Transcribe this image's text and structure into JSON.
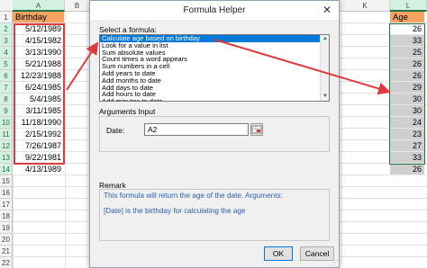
{
  "sheet": {
    "left_columns": [
      "A",
      "B"
    ],
    "right_columns": [
      "K",
      "L"
    ],
    "row_numbers": [
      "1",
      "2",
      "3",
      "4",
      "5",
      "6",
      "7",
      "8",
      "9",
      "10",
      "11",
      "12",
      "13",
      "14",
      "15",
      "16",
      "17",
      "18",
      "19",
      "20",
      "21",
      "22"
    ],
    "birthday_header": "Birthday",
    "birthdays": [
      "5/12/1989",
      "4/15/1982",
      "3/13/1990",
      "5/21/1988",
      "12/23/1988",
      "6/24/1985",
      "5/4/1985",
      "3/11/1985",
      "11/18/1990",
      "2/15/1992",
      "7/26/1987",
      "9/22/1981",
      "4/13/1989"
    ],
    "age_header": "Age",
    "ages": [
      "26",
      "33",
      "25",
      "26",
      "26",
      "29",
      "30",
      "30",
      "24",
      "23",
      "27",
      "33",
      "26"
    ]
  },
  "dialog": {
    "title": "Formula Helper",
    "close_label": "✕",
    "select_formula_label": "Select a formula:",
    "formulas": [
      "Calculate age based on birthday",
      "Look for a value in list",
      "Sum absolute values",
      "Count times a word appears",
      "Sum numbers in a cell",
      "Add years to date",
      "Add months to date",
      "Add days to date",
      "Add hours to date",
      "Add minutes to date"
    ],
    "arguments_label": "Arguments Input",
    "date_label": "Date:",
    "date_value": "A2",
    "remark_label": "Remark",
    "remark_line1": "This formula will return the age of the date. Arguments:",
    "remark_line2": "[Date] is the birthday for calculating the age",
    "ok_label": "OK",
    "cancel_label": "Cancel"
  },
  "colors": {
    "header_fill": "#f4a460",
    "annotation_red": "#e0393e",
    "selection_blue": "#0078d7",
    "remark_blue": "#2a5db0"
  }
}
